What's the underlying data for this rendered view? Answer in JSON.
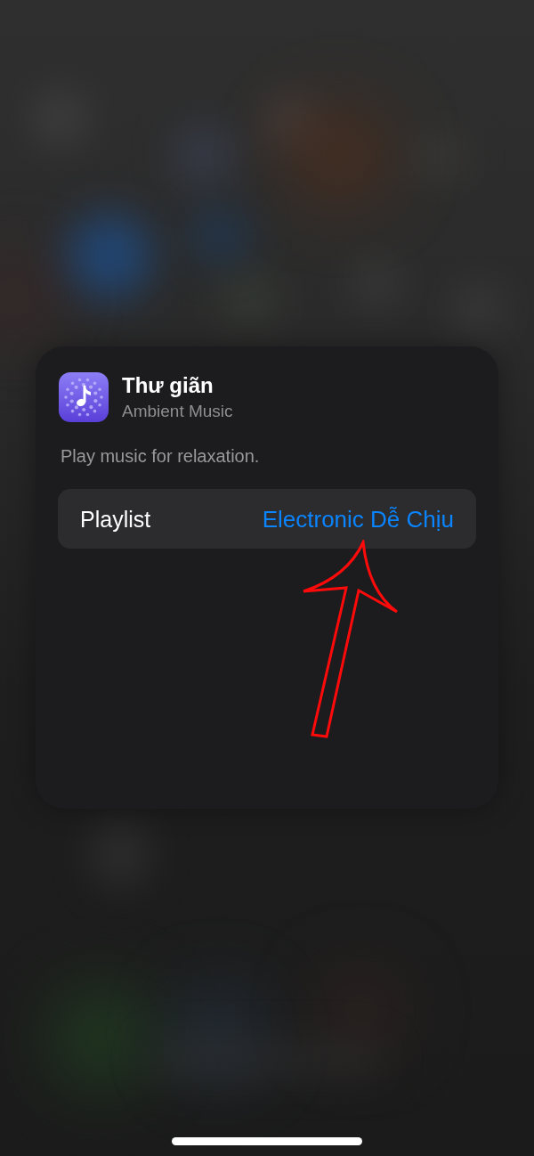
{
  "widget": {
    "app_name": "Thư giãn",
    "app_subtitle": "Ambient Music",
    "description": "Play music for relaxation.",
    "parameters": [
      {
        "label": "Playlist",
        "value": "Electronic Dễ Chịu"
      }
    ]
  }
}
